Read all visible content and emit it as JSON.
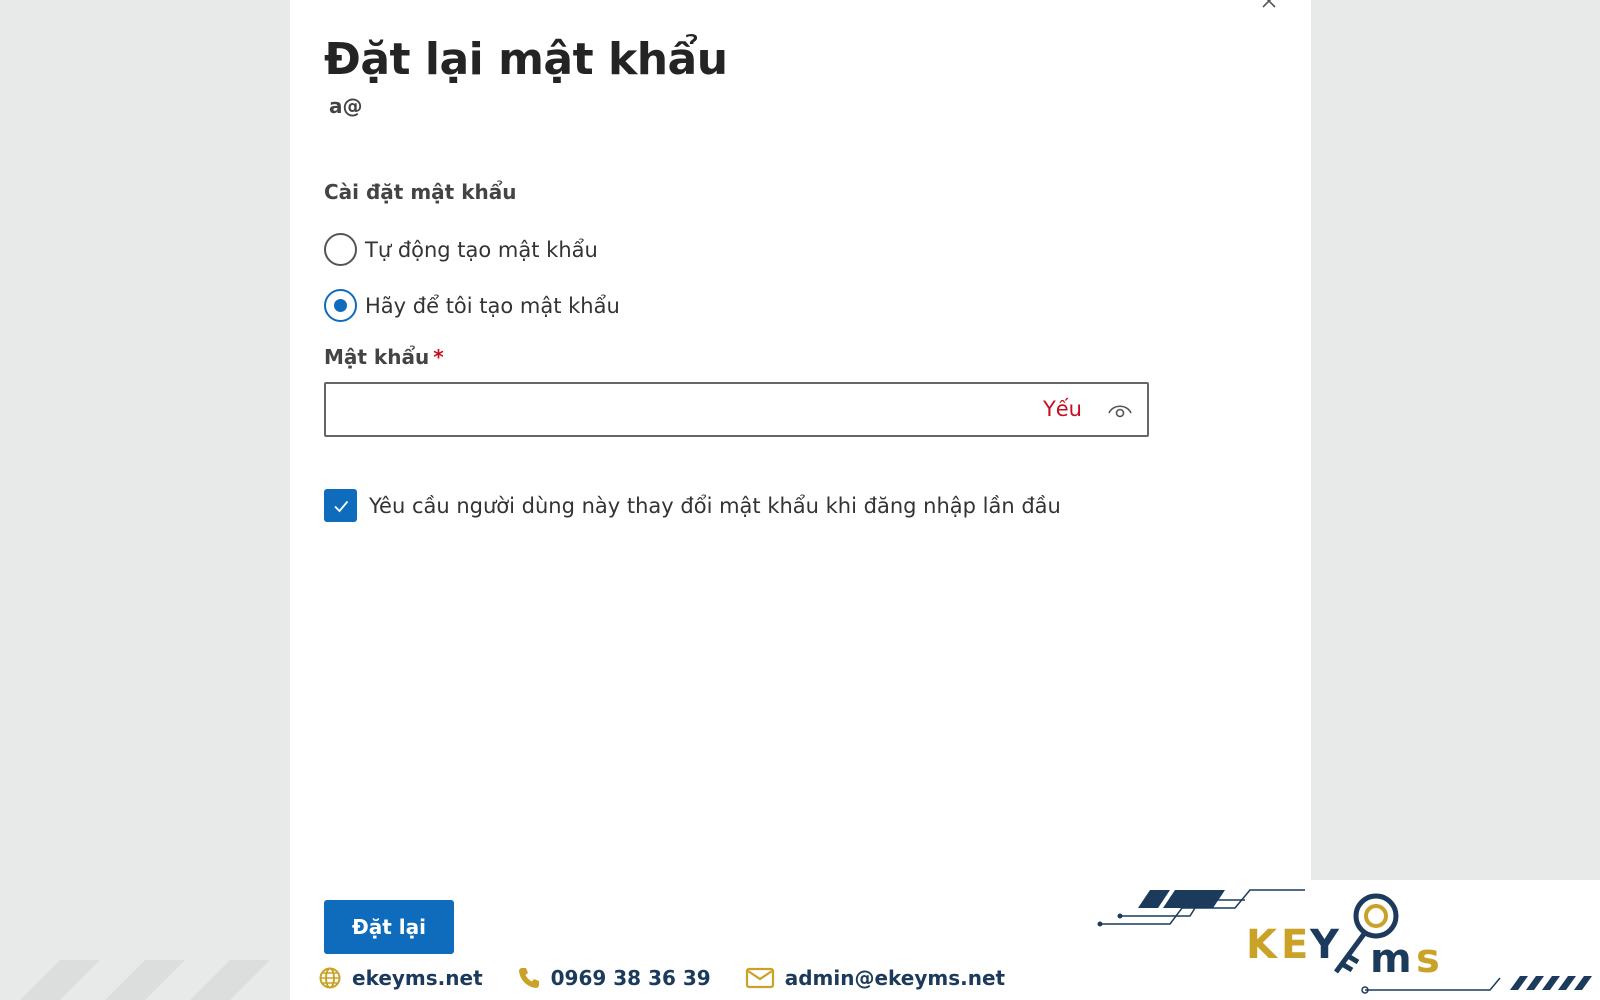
{
  "dialog": {
    "title": "Đặt lại mật khẩu",
    "subtitle": "a@",
    "password_settings_label": "Cài đặt mật khẩu",
    "options": [
      {
        "label": "Tự động tạo mật khẩu",
        "selected": false
      },
      {
        "label": "Hãy để tôi tạo mật khẩu",
        "selected": true
      }
    ],
    "password_label": "Mật khẩu",
    "required_marker": "*",
    "password_value": "",
    "strength_text": "Yếu",
    "require_change_label": "Yêu cầu người dùng này thay đổi mật khẩu khi đăng nhập lần đầu",
    "require_change_checked": true,
    "reset_button": "Đặt lại"
  },
  "footer": {
    "website": "ekeyms.net",
    "phone": "0969 38 36 39",
    "email": "admin@ekeyms.net"
  },
  "brand": {
    "logo_text": "KEYMS",
    "navy": "#1b3a5c",
    "gold": "#c9a227"
  },
  "colors": {
    "accent": "#0f6cbd",
    "error": "#c50f1f",
    "background": "#e8e9e9"
  }
}
